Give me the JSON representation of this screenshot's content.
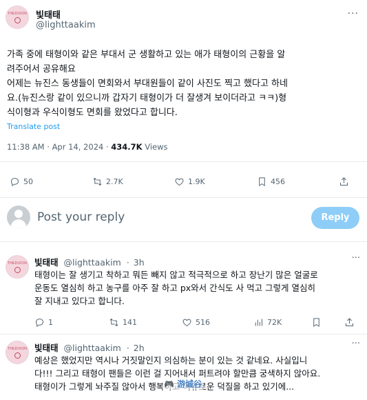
{
  "tweet": {
    "author_name": "빛태태",
    "author_handle": "@lighttaakim",
    "avatar_text": "THEDIXON",
    "more": "···",
    "body_lines": [
      "가족 중에 태형이와 같은 부대서 군 생활하고 있는 애가 태형이의 근황을 알",
      "려주어서 공유해요",
      "어제는 뉴진스 동생들이 면회와서  부대원들이 같이 사진도 찍고 했다고 하네",
      "요.(뉴진스랑 같이 있으니까 갑자기 태형이가 더 잘생겨 보이더라고 ㅋㅋ)형",
      "식이형과 우식이형도 면회를 왔었다고 합니다."
    ],
    "translate_label": "Translate post",
    "time": "11:38 AM",
    "date": "Apr 14, 2024",
    "views_count": "434.7K",
    "views_label": "Views",
    "stats": {
      "replies": "50",
      "reposts": "2.7K",
      "likes": "1.9K",
      "bookmarks": "456"
    }
  },
  "reply_box": {
    "placeholder": "Post your reply",
    "button": "Reply"
  },
  "replies": [
    {
      "author_name": "빛태태",
      "author_handle": "@lighttaakim",
      "time": "3h",
      "lines": [
        "태형이는 잘 생기고 착하고 뭐든 빼지 않고 적극적으로 하고 장난기 많은 얼굴로",
        "운동도 열심히 하고 농구를 아주 잘 하고 px와서 간식도 사 먹고 그렇게 열심히",
        "잘 지내고 있다고 합니다."
      ],
      "stats": {
        "replies": "1",
        "reposts": "141",
        "likes": "516",
        "views": "72K"
      }
    },
    {
      "author_name": "빛태태",
      "author_handle": "@lighttaakim",
      "time": "2h",
      "lines": [
        "예상은 했었지만 역시나 거짓말인지 의심하는 분이 있는 것 같네요. 사실입니",
        "다!!! 그리고 태형이 팬들은 이런 걸 지어내서 퍼트려야 할만큼 궁색하지 않아요.",
        "태형이가 그렇게 놔주질 않아서 행복하고 여유로운 덕질을 하고 있기에..."
      ]
    }
  ],
  "watermark": "🎮 游城谷",
  "colors": {
    "accent": "#1d9bf0",
    "reply_button": "#8ecdf7",
    "secondary_text": "#536471"
  },
  "icons": [
    "more-icon",
    "reply-icon",
    "repost-icon",
    "like-icon",
    "bookmark-icon",
    "share-icon",
    "views-icon",
    "avatar-person-icon"
  ]
}
